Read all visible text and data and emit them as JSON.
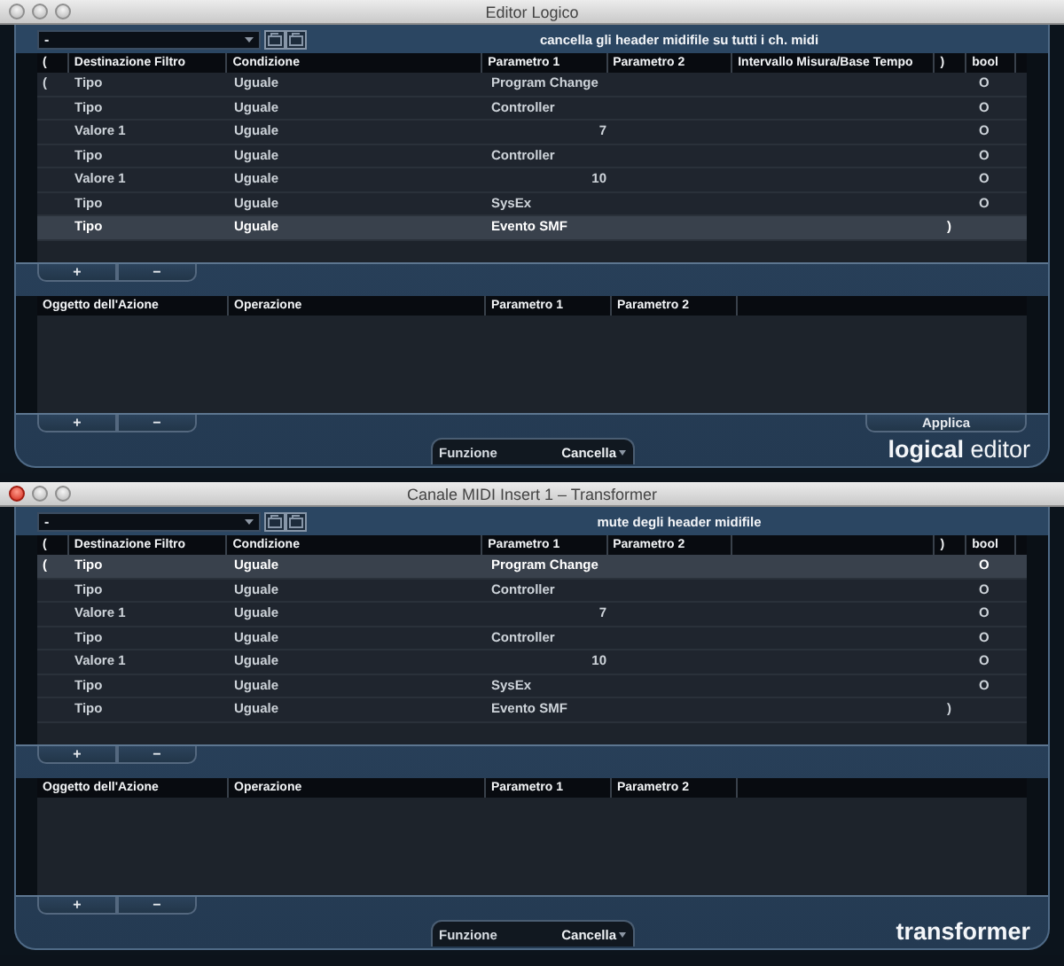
{
  "windows": [
    {
      "title": "Editor Logico",
      "active": false,
      "preset": {
        "value": "-",
        "name": "cancella gli header midifile su tutti i ch. midi"
      },
      "filter_table": {
        "columns": [
          {
            "label": "("
          },
          {
            "label": "Destinazione Filtro"
          },
          {
            "label": "Condizione"
          },
          {
            "label": "Parametro 1"
          },
          {
            "label": "Parametro 2"
          },
          {
            "label": "Intervallo Misura/Base Tempo"
          },
          {
            "label": ")"
          },
          {
            "label": "bool"
          }
        ],
        "rows": [
          {
            "kind": "type",
            "selected": false,
            "open": "(",
            "target": "Tipo",
            "condition": "Uguale",
            "param1": "Program Change",
            "bool": "O"
          },
          {
            "kind": "type",
            "selected": false,
            "target": "Tipo",
            "condition": "Uguale",
            "param1": "Controller",
            "bool": "O"
          },
          {
            "kind": "value",
            "selected": false,
            "target": "Valore 1",
            "condition": "Uguale",
            "param1": "7",
            "bool": "O"
          },
          {
            "kind": "type",
            "selected": false,
            "target": "Tipo",
            "condition": "Uguale",
            "param1": "Controller",
            "bool": "O"
          },
          {
            "kind": "value",
            "selected": false,
            "target": "Valore 1",
            "condition": "Uguale",
            "param1": "10",
            "bool": "O"
          },
          {
            "kind": "type",
            "selected": false,
            "target": "Tipo",
            "condition": "Uguale",
            "param1": "SysEx",
            "bool": "O"
          },
          {
            "kind": "type",
            "selected": true,
            "target": "Tipo",
            "condition": "Uguale",
            "param1": "Evento SMF",
            "close": ")"
          }
        ]
      },
      "filter_buttons": [
        "+",
        "−"
      ],
      "action_table": {
        "columns": [
          {
            "label": "Oggetto dell'Azione"
          },
          {
            "label": "Operazione"
          },
          {
            "label": "Parametro 1"
          },
          {
            "label": "Parametro 2"
          }
        ]
      },
      "action_buttons": [
        "+",
        "−"
      ],
      "apply_button": "Applica",
      "function": {
        "label": "Funzione",
        "value": "Cancella"
      },
      "logo": {
        "text": "**logical** editor",
        "bold": false
      }
    },
    {
      "title": "Canale MIDI Insert 1 – Transformer",
      "active": true,
      "preset": {
        "value": "-",
        "name": "mute degli header midifile"
      },
      "filter_table": {
        "columns": [
          {
            "label": "("
          },
          {
            "label": "Destinazione Filtro"
          },
          {
            "label": "Condizione"
          },
          {
            "label": "Parametro 1"
          },
          {
            "label": "Parametro 2"
          },
          {},
          {
            "label": ")"
          },
          {
            "label": "bool"
          }
        ],
        "rows": [
          {
            "kind": "type",
            "selected": true,
            "open": "(",
            "target": "Tipo",
            "condition": "Uguale",
            "param1": "Program Change",
            "bool": "O"
          },
          {
            "kind": "type",
            "selected": false,
            "target": "Tipo",
            "condition": "Uguale",
            "param1": "Controller",
            "bool": "O"
          },
          {
            "kind": "value",
            "selected": false,
            "target": "Valore 1",
            "condition": "Uguale",
            "param1": "7",
            "bool": "O"
          },
          {
            "kind": "type",
            "selected": false,
            "target": "Tipo",
            "condition": "Uguale",
            "param1": "Controller",
            "bool": "O"
          },
          {
            "kind": "value",
            "selected": false,
            "target": "Valore 1",
            "condition": "Uguale",
            "param1": "10",
            "bool": "O"
          },
          {
            "kind": "type",
            "selected": false,
            "target": "Tipo",
            "condition": "Uguale",
            "param1": "SysEx",
            "bool": "O"
          },
          {
            "kind": "type",
            "selected": false,
            "target": "Tipo",
            "condition": "Uguale",
            "param1": "Evento SMF",
            "close": ")"
          }
        ]
      },
      "filter_buttons": [
        "+",
        "−"
      ],
      "action_table": {
        "columns": [
          {
            "label": "Oggetto dell'Azione"
          },
          {
            "label": "Operazione"
          },
          {
            "label": "Parametro 1"
          },
          {
            "label": "Parametro 2"
          }
        ]
      },
      "action_buttons": [
        "+",
        "−"
      ],
      "function": {
        "label": "Funzione",
        "value": "Cancella"
      },
      "logo": {
        "text": "transformer",
        "bold": true
      }
    }
  ]
}
